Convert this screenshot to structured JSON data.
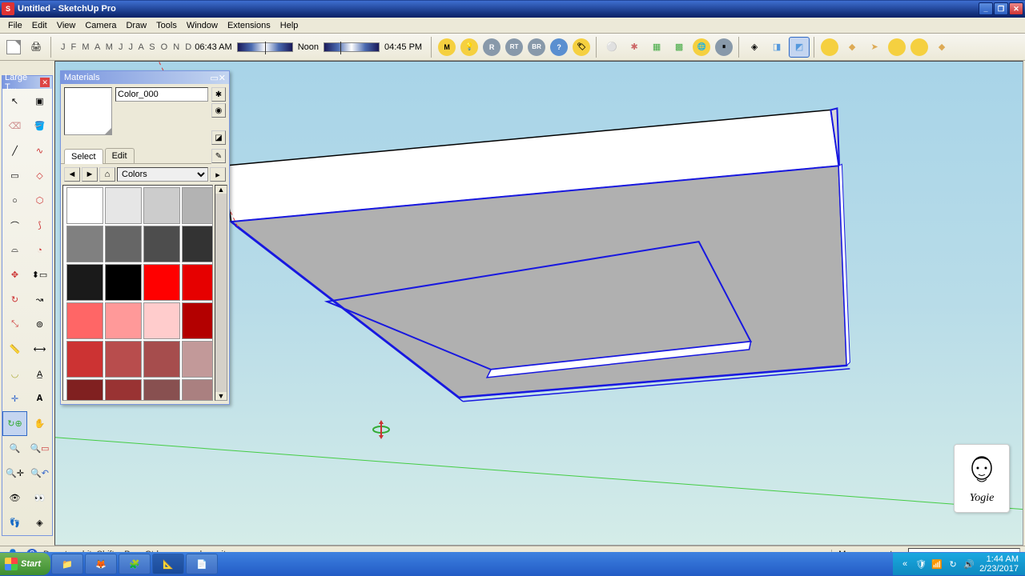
{
  "title": "Untitled - SketchUp Pro",
  "menus": [
    "File",
    "Edit",
    "View",
    "Camera",
    "Draw",
    "Tools",
    "Window",
    "Extensions",
    "Help"
  ],
  "months": "J F M A M J J A S O N D",
  "time_left": "06:43 AM",
  "time_mid": "Noon",
  "time_right": "04:45 PM",
  "palette_title": "Large T...",
  "materials": {
    "title": "Materials",
    "name": "Color_000",
    "tabs": {
      "select": "Select",
      "edit": "Edit"
    },
    "library": "Colors",
    "swatches": [
      "#ffffff",
      "#e6e6e6",
      "#cccccc",
      "#b3b3b3",
      "#808080",
      "#666666",
      "#4d4d4d",
      "#333333",
      "#1a1a1a",
      "#000000",
      "#ff0000",
      "#e60000",
      "#ff6666",
      "#ff9999",
      "#ffcccc",
      "#b30000",
      "#cc3333",
      "#b84d4d",
      "#a64d4d",
      "#c29999",
      "#802020",
      "#993333",
      "#885050",
      "#aa8080"
    ]
  },
  "status_hint": "Drag to orbit. Shift = Pan, Ctrl = suspend gravity.",
  "measurements_label": "Measurements",
  "watermark_name": "Yogie",
  "taskbar": {
    "start": "Start",
    "clock_time": "1:44 AM",
    "clock_date": "2/23/2017"
  }
}
